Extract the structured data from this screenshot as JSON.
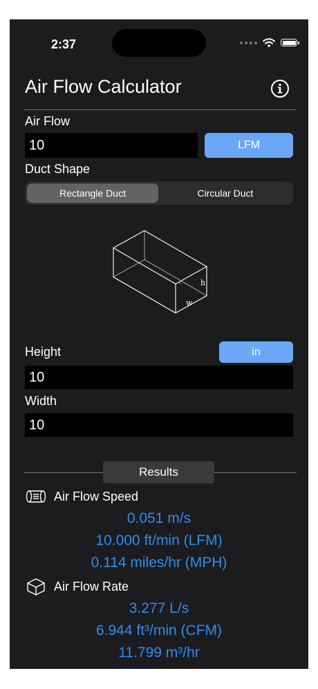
{
  "status_bar": {
    "time": "2:37"
  },
  "header": {
    "title": "Air Flow Calculator"
  },
  "air_flow": {
    "label": "Air Flow",
    "value": "10",
    "unit_button": "LFM"
  },
  "duct_shape": {
    "label": "Duct Shape",
    "options": [
      "Rectangle Duct",
      "Circular Duct"
    ],
    "selected": "Rectangle Duct",
    "diagram_labels": {
      "h": "h",
      "w": "w"
    }
  },
  "dimensions": {
    "height_label": "Height",
    "height_value": "10",
    "unit_button": "in",
    "width_label": "Width",
    "width_value": "10"
  },
  "results": {
    "title": "Results",
    "speed": {
      "label": "Air Flow Speed",
      "values": [
        "0.051 m/s",
        "10.000 ft/min (LFM)",
        "0.114 miles/hr (MPH)"
      ]
    },
    "rate": {
      "label": "Air Flow Rate",
      "values": [
        "3.277 L/s",
        "6.944 ft³/min (CFM)",
        "11.799 m³/hr"
      ]
    }
  },
  "colors": {
    "accent_button": "#6aa8f7",
    "result_text": "#2f8cf0",
    "background": "#1c1c1e"
  }
}
